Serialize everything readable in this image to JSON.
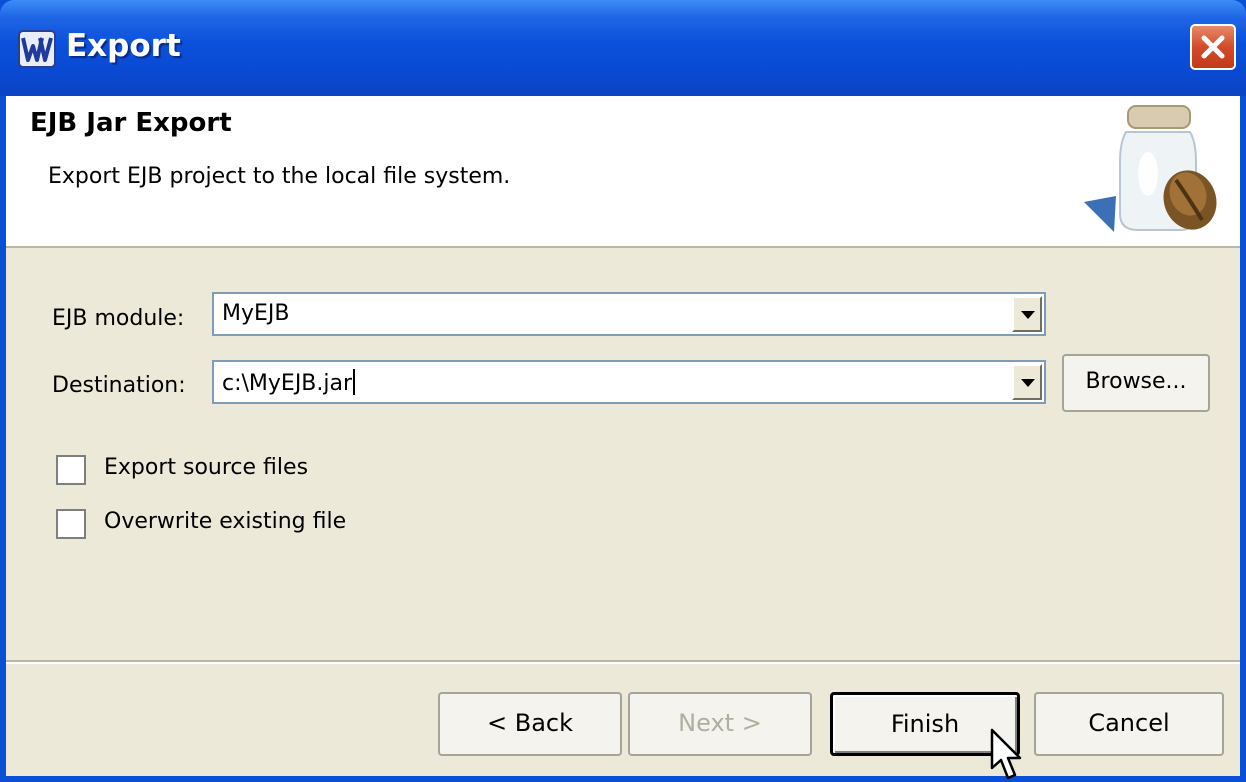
{
  "window": {
    "title": "Export",
    "app_icon": "w-app-icon",
    "close_icon": "close-icon"
  },
  "banner": {
    "title": "EJB Jar Export",
    "description": "Export EJB project to the local file system.",
    "icon": "jar-with-coffee-bean-icon"
  },
  "form": {
    "module_label": "EJB module:",
    "module_value": "MyEJB",
    "destination_label": "Destination:",
    "destination_value": "c:\\MyEJB.jar",
    "browse_label": "Browse..."
  },
  "options": {
    "export_source_label": "Export source files",
    "export_source_checked": false,
    "overwrite_label": "Overwrite existing file",
    "overwrite_checked": false
  },
  "buttons": {
    "back": "< Back",
    "next": "Next >",
    "finish": "Finish",
    "cancel": "Cancel"
  }
}
